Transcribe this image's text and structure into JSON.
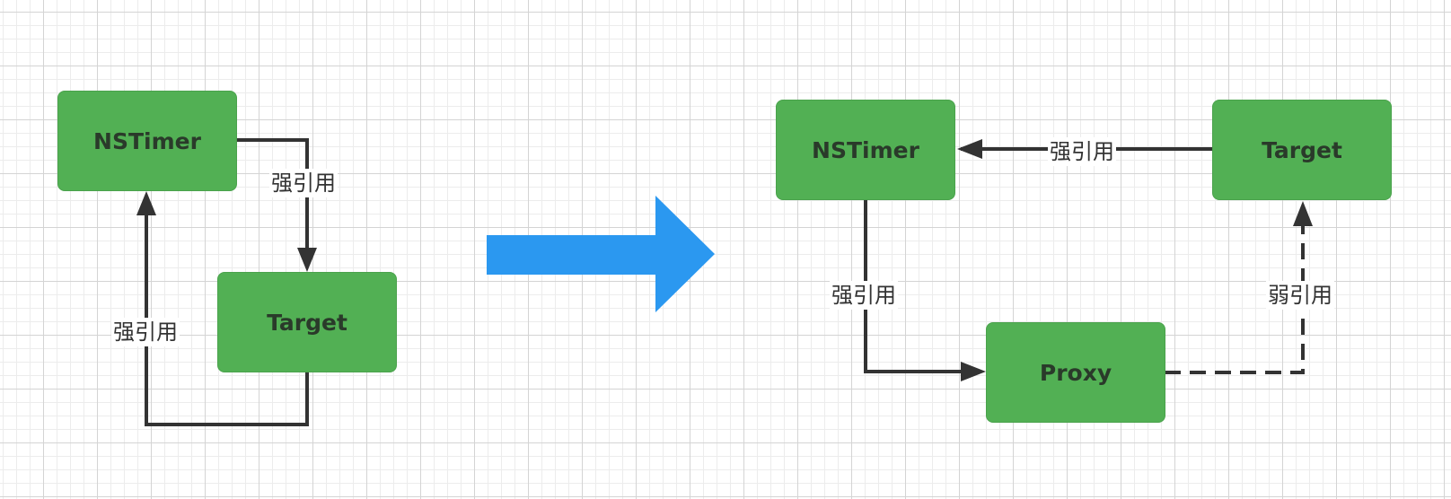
{
  "left": {
    "nodes": {
      "nstimer": "NSTimer",
      "target": "Target"
    },
    "edges": {
      "timer_to_target": "强引用",
      "target_to_timer": "强引用"
    }
  },
  "transition_arrow": {
    "color": "#2b98f0"
  },
  "right": {
    "nodes": {
      "nstimer": "NSTimer",
      "target": "Target",
      "proxy": "Proxy"
    },
    "edges": {
      "target_to_timer": "强引用",
      "timer_to_proxy": "强引用",
      "proxy_to_target": "弱引用"
    }
  },
  "colors": {
    "node_fill": "#52b054",
    "edge": "#333333",
    "grid": "#e0e0e0"
  }
}
